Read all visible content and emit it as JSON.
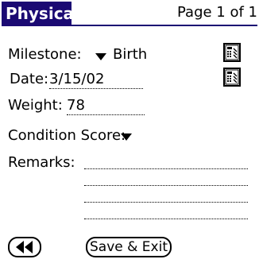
{
  "header": {
    "title": "Physical",
    "page_indicator": "Page 1 of 1"
  },
  "form": {
    "milestone": {
      "label": "Milestone:",
      "value": "Birth"
    },
    "date": {
      "label": "Date:",
      "value": "3/15/02"
    },
    "weight": {
      "label": "Weight:",
      "value": "78"
    },
    "condition_score": {
      "label": "Condition Score:"
    },
    "remarks": {
      "label": "Remarks:"
    }
  },
  "footer": {
    "save_label": "Save & Exit"
  },
  "icons": {
    "lookup": "keypad-lookup-icon",
    "nav": "rewind-icon",
    "dropdown": "dropdown-triangle-icon"
  },
  "colors": {
    "title_bar": "#1b0a73"
  }
}
